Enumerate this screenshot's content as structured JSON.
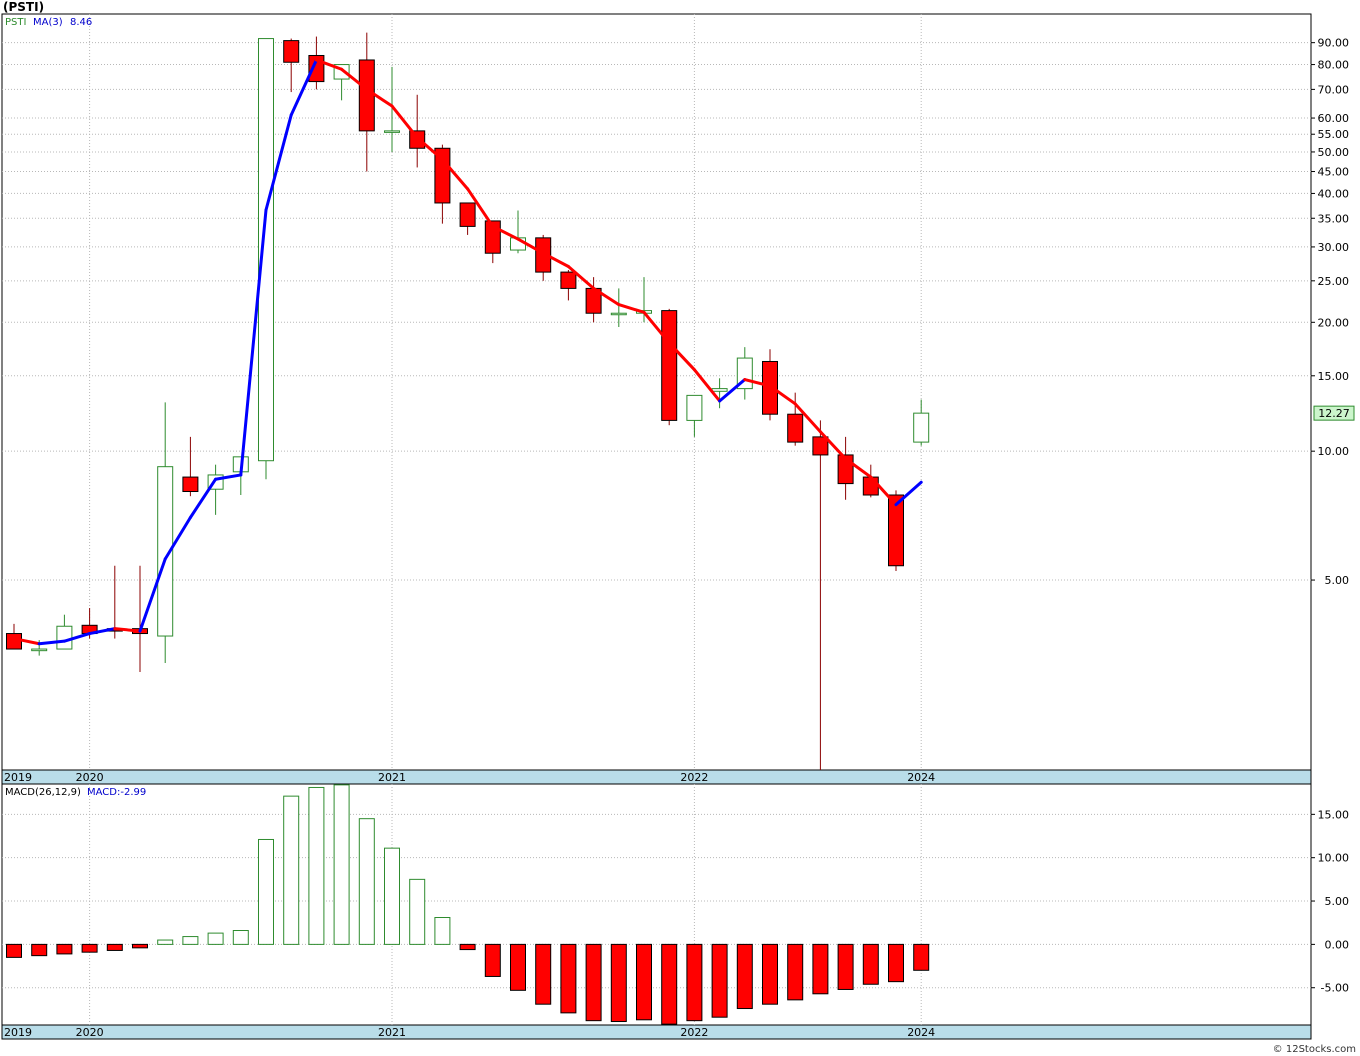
{
  "page": {
    "title": "(PSTI)",
    "watermark": "© 12Stocks.com"
  },
  "chart_data": [
    {
      "type": "candlestick",
      "legend": {
        "symbol": "PSTI",
        "indicator": "MA(3)",
        "indicator_value": "8.46"
      },
      "y_scale": "log",
      "ylim": [
        1.8,
        105
      ],
      "y_ticks": [
        "90.00",
        "80.00",
        "70.00",
        "60.00",
        "55.00",
        "50.00",
        "45.00",
        "40.00",
        "35.00",
        "30.00",
        "25.00",
        "20.00",
        "15.00",
        "10.00",
        "5.00"
      ],
      "y_tick_values": [
        90,
        80,
        70,
        60,
        55,
        50,
        45,
        40,
        35,
        30,
        25,
        20,
        15,
        10,
        5
      ],
      "x_labels": [
        {
          "label": "2019",
          "index": -0.5
        },
        {
          "label": "2020",
          "index": 3
        },
        {
          "label": "2021",
          "index": 15
        },
        {
          "label": "2022",
          "index": 27
        },
        {
          "label": "2024",
          "index": 36
        }
      ],
      "last_price_label": "12.27",
      "last_price": 12.27,
      "colors": {
        "up": "#2e8b2e",
        "down": "#ff0000",
        "ma_up": "#0000ff",
        "ma_down": "#ff0000"
      },
      "candles": [
        {
          "o": 3.75,
          "h": 3.95,
          "l": 3.45,
          "c": 3.45
        },
        {
          "o": 3.42,
          "h": 3.62,
          "l": 3.33,
          "c": 3.45
        },
        {
          "o": 3.45,
          "h": 4.15,
          "l": 3.45,
          "c": 3.9
        },
        {
          "o": 3.92,
          "h": 4.3,
          "l": 3.65,
          "c": 3.75
        },
        {
          "o": 3.85,
          "h": 5.4,
          "l": 3.65,
          "c": 3.8
        },
        {
          "o": 3.85,
          "h": 5.4,
          "l": 3.05,
          "c": 3.75
        },
        {
          "o": 3.7,
          "h": 13.0,
          "l": 3.2,
          "c": 9.2
        },
        {
          "o": 8.7,
          "h": 10.8,
          "l": 7.85,
          "c": 8.05
        },
        {
          "o": 8.15,
          "h": 9.3,
          "l": 7.1,
          "c": 8.8
        },
        {
          "o": 8.95,
          "h": 9.7,
          "l": 7.9,
          "c": 9.7
        },
        {
          "o": 9.5,
          "h": 92,
          "l": 8.6,
          "c": 92
        },
        {
          "o": 91,
          "h": 92,
          "l": 69,
          "c": 81
        },
        {
          "o": 84,
          "h": 93,
          "l": 70,
          "c": 73
        },
        {
          "o": 74,
          "h": 80,
          "l": 66,
          "c": 80
        },
        {
          "o": 82,
          "h": 95,
          "l": 45,
          "c": 56
        },
        {
          "o": 56,
          "h": 79,
          "l": 50,
          "c": 56
        },
        {
          "o": 56,
          "h": 68,
          "l": 46,
          "c": 51
        },
        {
          "o": 51,
          "h": 52,
          "l": 34,
          "c": 38
        },
        {
          "o": 38,
          "h": 38,
          "l": 32,
          "c": 33.5
        },
        {
          "o": 34.5,
          "h": 34.5,
          "l": 27.5,
          "c": 29
        },
        {
          "o": 29.5,
          "h": 36.5,
          "l": 29,
          "c": 31.5
        },
        {
          "o": 31.5,
          "h": 32,
          "l": 25,
          "c": 26.2
        },
        {
          "o": 26.2,
          "h": 26.5,
          "l": 22.5,
          "c": 24
        },
        {
          "o": 24,
          "h": 25.5,
          "l": 20,
          "c": 21
        },
        {
          "o": 21,
          "h": 24,
          "l": 19.5,
          "c": 21
        },
        {
          "o": 21,
          "h": 25.5,
          "l": 20,
          "c": 21.3
        },
        {
          "o": 21.3,
          "h": 21.5,
          "l": 11.5,
          "c": 11.8
        },
        {
          "o": 11.8,
          "h": 13.5,
          "l": 10.8,
          "c": 13.5
        },
        {
          "o": 13.8,
          "h": 14.8,
          "l": 12.6,
          "c": 14.0
        },
        {
          "o": 14.0,
          "h": 17.5,
          "l": 13.2,
          "c": 16.5
        },
        {
          "o": 16.2,
          "h": 17.3,
          "l": 11.8,
          "c": 12.2
        },
        {
          "o": 12.2,
          "h": 13.7,
          "l": 10.3,
          "c": 10.5
        },
        {
          "o": 10.8,
          "h": 11.8,
          "l": 1.0,
          "c": 9.8
        },
        {
          "o": 9.8,
          "h": 10.8,
          "l": 7.7,
          "c": 8.4
        },
        {
          "o": 8.7,
          "h": 9.3,
          "l": 7.8,
          "c": 7.9
        },
        {
          "o": 7.9,
          "h": 8.1,
          "l": 5.25,
          "c": 5.4
        },
        {
          "o": 10.5,
          "h": 13.2,
          "l": 10.3,
          "c": 12.27
        }
      ],
      "ma": [
        3.65,
        3.55,
        3.6,
        3.75,
        3.85,
        3.8,
        5.6,
        7.0,
        8.6,
        8.8,
        36.6,
        61,
        82,
        78,
        70,
        64,
        54,
        48,
        41,
        33.5,
        31.3,
        29,
        27,
        24,
        22,
        21.1,
        17.9,
        15.5,
        13.1,
        14.7,
        14.2,
        12.9,
        11.1,
        9.6,
        8.7,
        7.5,
        8.46
      ],
      "ma_color_break": [
        6,
        6,
        6,
        6,
        6,
        6,
        6,
        6,
        6,
        6,
        6,
        6,
        6,
        6,
        6,
        6,
        6,
        6,
        6,
        6,
        6,
        6,
        6,
        6,
        6,
        6,
        6,
        6,
        6,
        6,
        6,
        6,
        6,
        6,
        6,
        6,
        6
      ]
    },
    {
      "type": "bar",
      "legend": {
        "name": "MACD(26,12,9)",
        "value_label": "MACD:-2.99"
      },
      "ylim": [
        -9.3,
        18.5
      ],
      "y_ticks": [
        "15.00",
        "10.00",
        "5.00",
        "0.00",
        "-5.00"
      ],
      "y_tick_values": [
        15,
        10,
        5,
        0,
        -5
      ],
      "x_labels": [
        {
          "label": "2019",
          "index": -0.5
        },
        {
          "label": "2020",
          "index": 3
        },
        {
          "label": "2021",
          "index": 15
        },
        {
          "label": "2022",
          "index": 27
        },
        {
          "label": "2024",
          "index": 36
        }
      ],
      "values": [
        -1.5,
        -1.3,
        -1.1,
        -0.9,
        -0.7,
        -0.4,
        0.5,
        0.9,
        1.3,
        1.6,
        12.1,
        17.1,
        18.1,
        18.4,
        14.5,
        11.1,
        7.5,
        3.1,
        -0.6,
        -3.7,
        -5.3,
        -6.9,
        -7.9,
        -8.8,
        -8.9,
        -8.7,
        -9.2,
        -8.8,
        -8.4,
        -7.4,
        -6.9,
        -6.4,
        -5.7,
        -5.2,
        -4.6,
        -4.3,
        -2.99
      ],
      "colors": {
        "positive": "#2e8b2e",
        "negative": "#ff0000"
      }
    }
  ]
}
